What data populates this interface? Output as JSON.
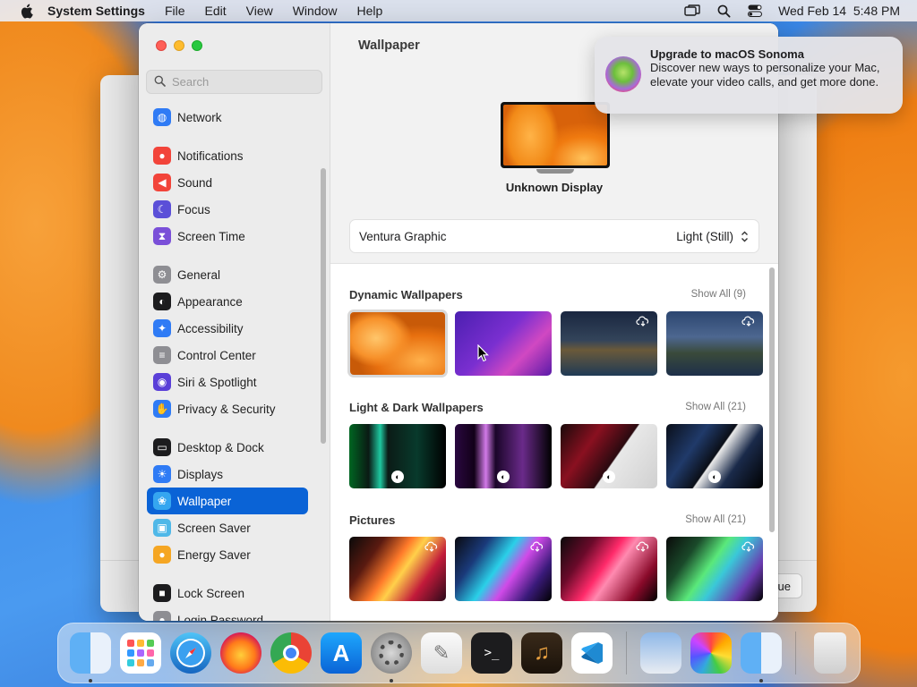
{
  "menubar": {
    "app_name": "System Settings",
    "menus": [
      "File",
      "Edit",
      "View",
      "Window",
      "Help"
    ],
    "clock": "Wed Feb 14  5:48 PM",
    "icons": [
      "screen-mirroring-icon",
      "spotlight-search-icon",
      "control-center-icon"
    ]
  },
  "settings": {
    "search_placeholder": "Search",
    "sidebar": {
      "groups": [
        [
          {
            "label": "Network",
            "icon": "network-icon",
            "color": "#2f7bf5"
          }
        ],
        [
          {
            "label": "Notifications",
            "icon": "notifications-icon",
            "color": "#f2443a"
          },
          {
            "label": "Sound",
            "icon": "sound-icon",
            "color": "#f2443a"
          },
          {
            "label": "Focus",
            "icon": "focus-icon",
            "color": "#5b4fd8"
          },
          {
            "label": "Screen Time",
            "icon": "screen-time-icon",
            "color": "#7a4fd8"
          }
        ],
        [
          {
            "label": "General",
            "icon": "general-icon",
            "color": "#8e8e93"
          },
          {
            "label": "Appearance",
            "icon": "appearance-icon",
            "color": "#1c1c1e"
          },
          {
            "label": "Accessibility",
            "icon": "accessibility-icon",
            "color": "#2f7bf5"
          },
          {
            "label": "Control Center",
            "icon": "control-center-icon",
            "color": "#8e8e93"
          },
          {
            "label": "Siri & Spotlight",
            "icon": "siri-icon",
            "color": "#5a3fd8"
          },
          {
            "label": "Privacy & Security",
            "icon": "privacy-hand-icon",
            "color": "#2f7bf5"
          }
        ],
        [
          {
            "label": "Desktop & Dock",
            "icon": "desktop-dock-icon",
            "color": "#1c1c1e"
          },
          {
            "label": "Displays",
            "icon": "displays-icon",
            "color": "#2f7bf5"
          },
          {
            "label": "Wallpaper",
            "icon": "wallpaper-icon",
            "color": "#35a6f0",
            "selected": true
          },
          {
            "label": "Screen Saver",
            "icon": "screen-saver-icon",
            "color": "#4fb8e8"
          },
          {
            "label": "Energy Saver",
            "icon": "energy-saver-icon",
            "color": "#f5a623"
          }
        ],
        [
          {
            "label": "Lock Screen",
            "icon": "lock-screen-icon",
            "color": "#1c1c1e"
          },
          {
            "label": "Login Password",
            "icon": "login-password-icon",
            "color": "#8e8e93"
          }
        ]
      ]
    },
    "pane": {
      "title": "Wallpaper",
      "display_name": "Unknown Display",
      "current_wallpaper": "Ventura Graphic",
      "mode": "Light (Still)",
      "sections": [
        {
          "title": "Dynamic Wallpapers",
          "show_all": "Show All (9)",
          "thumbs": [
            {
              "name": "ventura-orange",
              "bg": "radial-gradient(ellipse 50px 40px at 30px 30px,#ffc66b 0%,#f7912a 55%,rgba(0,0,0,0) 80%),radial-gradient(ellipse 70px 40px at 80px 55px,#ffb04a 0%,#e8700f 70%,#c85a08 100%)",
              "selected": true
            },
            {
              "name": "monterey-purple",
              "bg": "linear-gradient(135deg,#4b1fb0 0%,#7a2fd0 45%,#d148c2 70%,#5a1aa8 100%)"
            },
            {
              "name": "catalina-coast",
              "bg": "linear-gradient(180deg,#1a2740 0%,#33445a 45%,#6a5a3a 60%,#1f3a55 100%)",
              "cloud": true
            },
            {
              "name": "catalina-island",
              "bg": "linear-gradient(180deg,#2c4670 0%,#4d6790 40%,#3a4a3a 65%,#1d2f4a 100%)",
              "cloud": true
            }
          ]
        },
        {
          "title": "Light & Dark Wallpapers",
          "show_all": "Show All (21)",
          "thumbs": [
            {
              "name": "macbook-green",
              "bg": "linear-gradient(90deg,#062 0%,#0a1a14 20%,#1ec8a0 32%,#0b1b16 40%,#083a2c 70%,#000 100%)",
              "badge": true
            },
            {
              "name": "macbook-purple",
              "bg": "linear-gradient(90deg,#2a0840 0%,#120018 20%,#d27ae8 32%,#1a0528 42%,#6a2a8a 70%,#000 100%)",
              "badge": true
            },
            {
              "name": "macbook-red",
              "bg": "linear-gradient(125deg,#1a0a0a 0%,#8a1020 30%,#2a0a10 55%,#e8e8e8 56%,#d0d0d0 100%)",
              "badge": true
            },
            {
              "name": "macbook-blue",
              "bg": "linear-gradient(125deg,#0a0f1a 0%,#203a6a 30%,#0b0f18 50%,#eaeaea 51%,#1a2a4a 70%,#000 100%)",
              "badge": true
            }
          ]
        },
        {
          "title": "Pictures",
          "show_all": "Show All (21)",
          "thumbs": [
            {
              "name": "macbook-pro-orange",
              "bg": "linear-gradient(125deg,#0a0a0a 0%,#5a1a10 25%,#ff7a2a 45%,#ffd04a 55%,#c21a3a 75%,#2a0a1a 100%)",
              "cloud": true
            },
            {
              "name": "macbook-pro-cyan",
              "bg": "linear-gradient(125deg,#0a0a10 0%,#1a3a7a 25%,#2ad0e8 45%,#d04ae8 60%,#3a1a7a 80%,#000 100%)",
              "cloud": true
            },
            {
              "name": "macbook-pro-pink",
              "bg": "linear-gradient(125deg,#0a0a0a 0%,#6a0a2a 25%,#ff2a6a 45%,#ff8ab0 55%,#8a0a2a 80%,#000 100%)",
              "cloud": true
            },
            {
              "name": "macbook-pro-green",
              "bg": "linear-gradient(125deg,#0a0a0a 0%,#1a4a2a 25%,#5ae87a 45%,#3ac8d8 58%,#6a3ab0 80%,#000 100%)",
              "cloud": true
            }
          ]
        }
      ]
    }
  },
  "notification": {
    "title": "Upgrade to macOS Sonoma",
    "body": "Discover new ways to personalize your Mac, elevate your video calls, and get more done."
  },
  "background_dialog": {
    "button_label": "ue"
  },
  "dock": {
    "apps": [
      {
        "name": "finder-icon",
        "running": true,
        "bg": "linear-gradient(90deg,#5fb0f5 50%,#e9f1fb 50%)"
      },
      {
        "name": "launchpad-icon",
        "running": false,
        "bg": "#ffffff"
      },
      {
        "name": "safari-icon",
        "running": false,
        "bg": "linear-gradient(180deg,#4fc3f7,#1565c0)"
      },
      {
        "name": "firefox-icon",
        "running": false,
        "bg": "radial-gradient(circle at 50% 55%,#ffcf3a 0%,#ff7a1a 45%,#d4145a 75%,#4a1aa0 100%)"
      },
      {
        "name": "chrome-icon",
        "running": false,
        "bg": "conic-gradient(#ea4335 0 120deg,#fbbc05 120deg 240deg,#34a853 240deg 360deg)"
      },
      {
        "name": "app-store-icon",
        "running": false,
        "bg": "linear-gradient(180deg,#1ea7fd,#0a63d6)"
      },
      {
        "name": "system-settings-icon",
        "running": true,
        "bg": "radial-gradient(circle,#d8d8d8 0%,#9a9a9a 60%,#6a6a6a 100%)"
      },
      {
        "name": "textedit-icon",
        "running": false,
        "bg": "linear-gradient(180deg,#fafafa,#dedede)"
      },
      {
        "name": "terminal-icon",
        "running": false,
        "bg": "#1c1c1e"
      },
      {
        "name": "garageband-icon",
        "running": false,
        "bg": "linear-gradient(180deg,#3a2a1a,#1a120a)"
      },
      {
        "name": "vscode-icon",
        "running": false,
        "bg": "#ffffff"
      },
      {
        "name": "preview-icon",
        "running": false,
        "bg": "linear-gradient(180deg,#8fb8e8,#e8ecf2)",
        "after_separator": true
      },
      {
        "name": "photos-icon",
        "running": false,
        "bg": "conic-gradient(#f44,#fa0,#fd3,#4c4,#3ad,#55f,#c4f,#f44)"
      },
      {
        "name": "finder-window-icon",
        "running": true,
        "bg": "linear-gradient(90deg,#5fb0f5 50%,#e9f1fb 50%)"
      },
      {
        "name": "trash-icon",
        "running": false,
        "bg": "linear-gradient(180deg,#f2f2f2,#cfcfcf)",
        "after_separator": true
      }
    ]
  }
}
